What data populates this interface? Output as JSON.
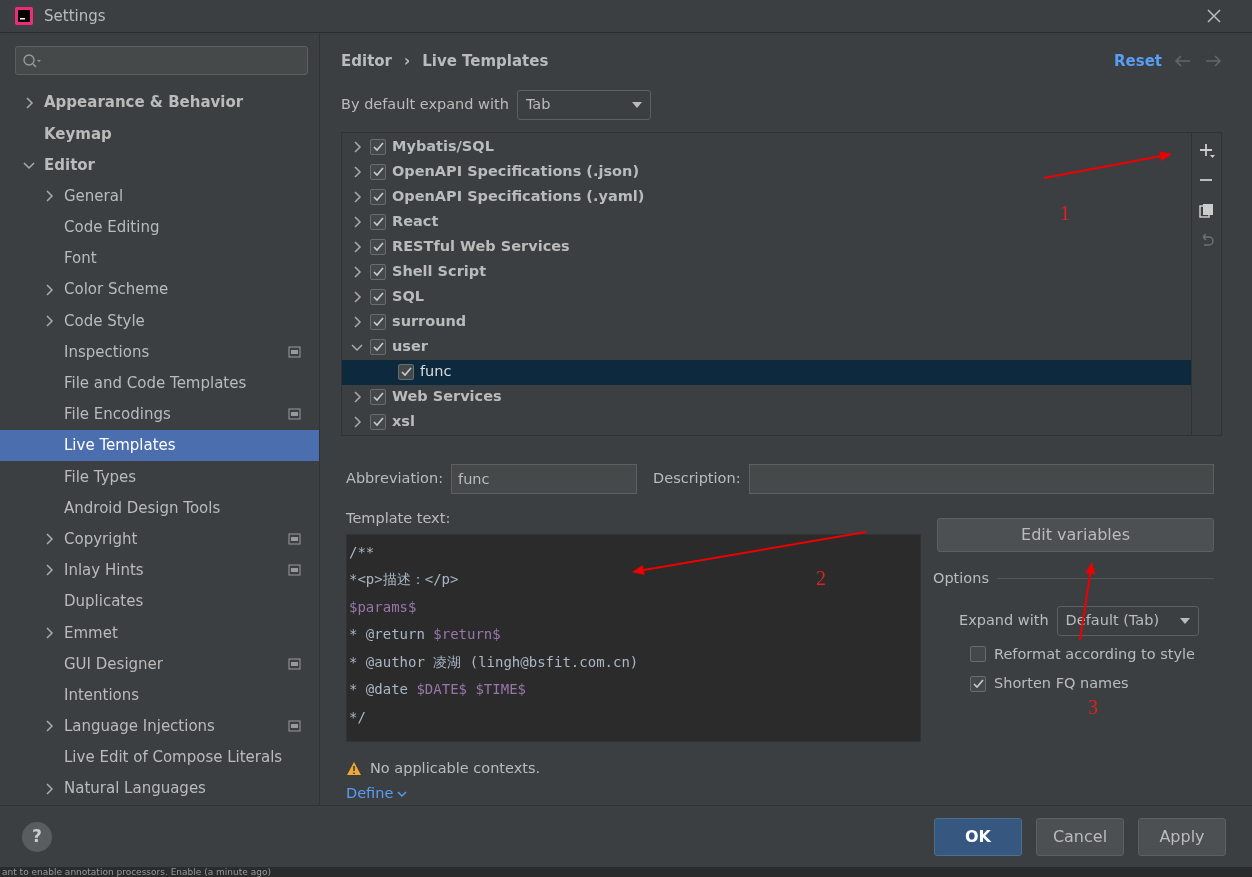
{
  "window": {
    "title": "Settings"
  },
  "help": "?",
  "sidebar": {
    "items": [
      {
        "label": "Appearance & Behavior",
        "expanded": false,
        "selected": false,
        "project_level": false
      },
      {
        "label": "Keymap",
        "selected": false,
        "project_level": false
      },
      {
        "label": "Editor",
        "expanded": true,
        "selected": false,
        "project_level": false,
        "children": [
          {
            "label": "General",
            "expanded": false,
            "selected": false,
            "project_level": false
          },
          {
            "label": "Code Editing",
            "selected": false,
            "project_level": false
          },
          {
            "label": "Font",
            "selected": false,
            "project_level": false
          },
          {
            "label": "Color Scheme",
            "expanded": false,
            "selected": false,
            "project_level": false
          },
          {
            "label": "Code Style",
            "expanded": false,
            "selected": false,
            "project_level": false
          },
          {
            "label": "Inspections",
            "selected": false,
            "project_level": true
          },
          {
            "label": "File and Code Templates",
            "selected": false,
            "project_level": false
          },
          {
            "label": "File Encodings",
            "selected": false,
            "project_level": true
          },
          {
            "label": "Live Templates",
            "selected": true,
            "project_level": false
          },
          {
            "label": "File Types",
            "selected": false,
            "project_level": false
          },
          {
            "label": "Android Design Tools",
            "selected": false,
            "project_level": false
          },
          {
            "label": "Copyright",
            "expanded": false,
            "selected": false,
            "project_level": true
          },
          {
            "label": "Inlay Hints",
            "expanded": false,
            "selected": false,
            "project_level": true
          },
          {
            "label": "Duplicates",
            "selected": false,
            "project_level": false
          },
          {
            "label": "Emmet",
            "expanded": false,
            "selected": false,
            "project_level": false
          },
          {
            "label": "GUI Designer",
            "selected": false,
            "project_level": true
          },
          {
            "label": "Intentions",
            "selected": false,
            "project_level": false
          },
          {
            "label": "Language Injections",
            "expanded": false,
            "selected": false,
            "project_level": true
          },
          {
            "label": "Live Edit of Compose Literals",
            "selected": false,
            "project_level": false
          },
          {
            "label": "Natural Languages",
            "expanded": false,
            "selected": false,
            "project_level": false
          }
        ]
      }
    ]
  },
  "breadcrumb": [
    "Editor",
    "›",
    "Live Templates"
  ],
  "reset": "Reset",
  "expand_default": {
    "label": "By default expand with",
    "value": "Tab"
  },
  "templates": [
    {
      "label": "Mybatis/SQL",
      "expanded": false,
      "checked": true,
      "selected": false
    },
    {
      "label": "OpenAPI Specifications (.json)",
      "expanded": false,
      "checked": true,
      "selected": false
    },
    {
      "label": "OpenAPI Specifications (.yaml)",
      "expanded": false,
      "checked": true,
      "selected": false
    },
    {
      "label": "React",
      "expanded": false,
      "checked": true,
      "selected": false
    },
    {
      "label": "RESTful Web Services",
      "expanded": false,
      "checked": true,
      "selected": false
    },
    {
      "label": "Shell Script",
      "expanded": false,
      "checked": true,
      "selected": false
    },
    {
      "label": "SQL",
      "expanded": false,
      "checked": true,
      "selected": false
    },
    {
      "label": "surround",
      "expanded": false,
      "checked": true,
      "selected": false
    },
    {
      "label": "user",
      "expanded": true,
      "checked": true,
      "selected": false,
      "children": [
        {
          "label": "func",
          "checked": true,
          "selected": true
        }
      ]
    },
    {
      "label": "Web Services",
      "expanded": false,
      "checked": true,
      "selected": false
    },
    {
      "label": "xsl",
      "expanded": false,
      "checked": true,
      "selected": false
    }
  ],
  "toolbar": [
    {
      "kind": "add",
      "disabled": false
    },
    {
      "kind": "remove",
      "disabled": false
    },
    {
      "kind": "copy",
      "disabled": false
    },
    {
      "kind": "undo",
      "disabled": true
    }
  ],
  "abbreviation": {
    "label": "Abbreviation:",
    "value": "func"
  },
  "description": {
    "label": "Description:"
  },
  "template_text": {
    "label": "Template text:",
    "lines": [
      [
        {
          "text": "/**",
          "kind": "plain"
        }
      ],
      [
        {
          "text": "*<p>描述：</p>",
          "kind": "plain"
        }
      ],
      [
        {
          "text": "$params$",
          "kind": "var"
        }
      ],
      [
        {
          "text": "* @return ",
          "kind": "plain"
        },
        {
          "text": "$return$",
          "kind": "var"
        }
      ],
      [
        {
          "text": "* @author 凌湖 (lingh@bsfit.com.cn)",
          "kind": "plain"
        }
      ],
      [
        {
          "text": "* @date ",
          "kind": "plain"
        },
        {
          "text": "$DATE$ $TIME$",
          "kind": "var"
        }
      ],
      [
        {
          "text": "*/",
          "kind": "plain"
        }
      ]
    ]
  },
  "edit_variables": "Edit variables",
  "options": {
    "title": "Options",
    "expand_label": "Expand with",
    "expand_value": "Default (Tab)",
    "checks": [
      {
        "label": "Reformat according to style",
        "checked": false
      },
      {
        "label": "Shorten FQ names",
        "checked": true
      }
    ]
  },
  "warning": "No applicable contexts.",
  "define": "Define",
  "annotations": [
    {
      "label": "1"
    },
    {
      "label": "2"
    },
    {
      "label": "3"
    }
  ],
  "buttons": [
    {
      "label": "OK",
      "primary": true
    },
    {
      "label": "Cancel",
      "primary": false
    },
    {
      "label": "Apply",
      "primary": false
    }
  ],
  "background_status": "ant to enable annotation processors. Enable (a minute ago)"
}
